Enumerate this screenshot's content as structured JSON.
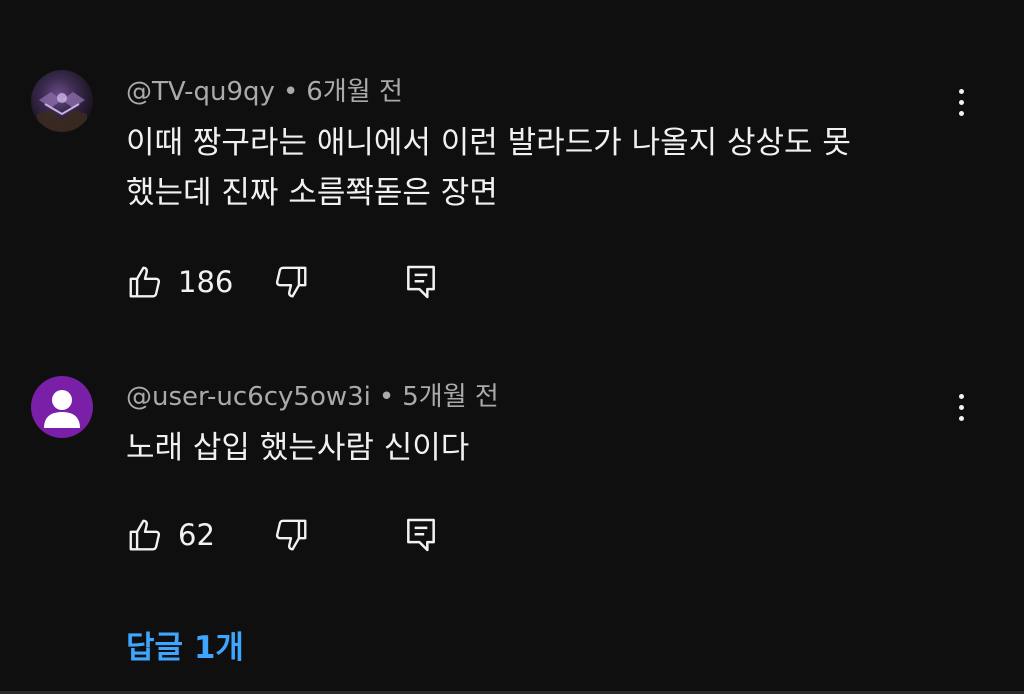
{
  "comments": [
    {
      "handle": "@TV-qu9qy",
      "separator": "•",
      "time": "6개월 전",
      "text_lines": [
        "이때 짱구라는 애니에서 이런 발라드가 나올지 상상도 못",
        "했는데 진짜 소름쫙돋은 장면"
      ],
      "likes": "186",
      "avatar": "photo"
    },
    {
      "handle": "@user-uc6cy5ow3i",
      "separator": "•",
      "time": "5개월 전",
      "text_lines": [
        "노래 삽입 했는사람 신이다"
      ],
      "likes": "62",
      "avatar": "default-person"
    }
  ],
  "replies_label": "답글 1개",
  "icons": {
    "like": "thumbs-up-icon",
    "dislike": "thumbs-down-icon",
    "reply": "reply-comment-icon",
    "menu": "more-vert-icon"
  },
  "colors": {
    "background": "#0f0f0f",
    "text": "#f1f1f1",
    "meta": "#aaaaaa",
    "link": "#3ea6ff",
    "default_avatar": "#7a1fa8"
  }
}
